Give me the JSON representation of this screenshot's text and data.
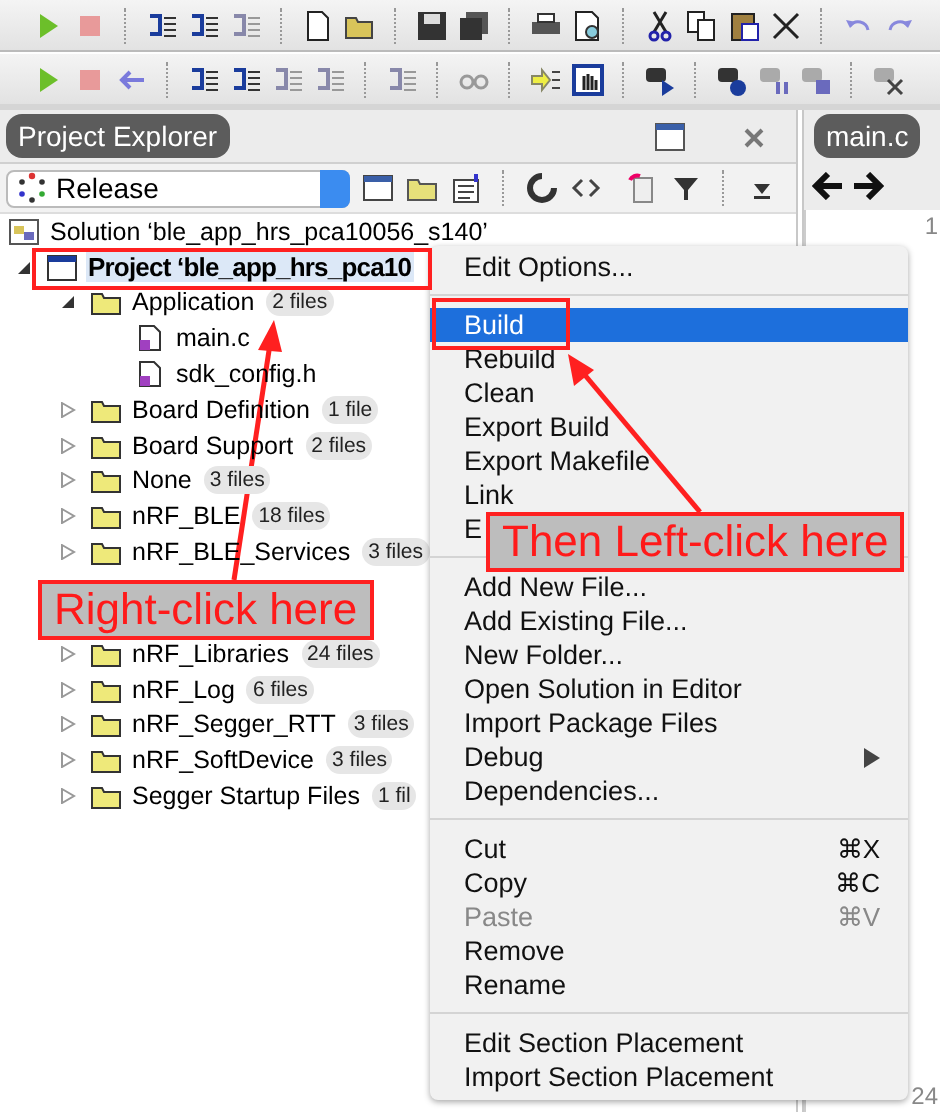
{
  "panel": {
    "title": "Project Explorer",
    "configuration": "Release"
  },
  "editor": {
    "tab": "main.c",
    "line_numbers": [
      "1",
      "24"
    ]
  },
  "tree": [
    {
      "kind": "solution",
      "label": "Solution ‘ble_app_hrs_pca10056_s140’",
      "selected": false,
      "children": [
        {
          "kind": "project",
          "label": "Project ‘ble_app_hrs_pca10",
          "selected": true,
          "expanded": true,
          "children": [
            {
              "kind": "folder",
              "label": "Application",
              "badge": "2 files",
              "selected": false,
              "expanded": true,
              "children": [
                {
                  "kind": "file",
                  "label": "main.c",
                  "selected": false
                },
                {
                  "kind": "file",
                  "label": "sdk_config.h",
                  "selected": false
                }
              ]
            },
            {
              "kind": "folder",
              "label": "Board Definition",
              "badge": "1 file",
              "selected": false,
              "expanded": false
            },
            {
              "kind": "folder",
              "label": "Board Support",
              "badge": "2 files",
              "selected": false,
              "expanded": false
            },
            {
              "kind": "folder",
              "label": "None",
              "badge": "3 files",
              "selected": false,
              "expanded": false
            },
            {
              "kind": "folder",
              "label": "nRF_BLE",
              "badge": "18 files",
              "selected": false,
              "expanded": false
            },
            {
              "kind": "folder",
              "label": "nRF_BLE_Services",
              "badge": "3 files",
              "selected": false,
              "expanded": false
            },
            {
              "kind": "folder",
              "label": "nRF_Libraries",
              "badge": "24 files",
              "selected": false,
              "expanded": false
            },
            {
              "kind": "folder",
              "label": "nRF_Log",
              "badge": "6 files",
              "selected": false,
              "expanded": false
            },
            {
              "kind": "folder",
              "label": "nRF_Segger_RTT",
              "badge": "3 files",
              "selected": false,
              "expanded": false
            },
            {
              "kind": "folder",
              "label": "nRF_SoftDevice",
              "badge": "3 files",
              "selected": false,
              "expanded": false
            },
            {
              "kind": "folder",
              "label": "Segger Startup Files",
              "badge": "1 fil",
              "selected": false,
              "expanded": false
            }
          ]
        }
      ]
    }
  ],
  "context_menu": {
    "sections": [
      [
        {
          "label": "Edit Options...",
          "selected": false,
          "disabled": false,
          "submenu": false
        }
      ],
      [
        {
          "label": "Build",
          "selected": true,
          "disabled": false,
          "submenu": false
        },
        {
          "label": "Rebuild",
          "selected": false,
          "disabled": false,
          "submenu": false
        },
        {
          "label": "Clean",
          "selected": false,
          "disabled": false,
          "submenu": false
        },
        {
          "label": "Export Build",
          "selected": false,
          "disabled": false,
          "submenu": false
        },
        {
          "label": "Export Makefile",
          "selected": false,
          "disabled": false,
          "submenu": false
        },
        {
          "label": "Link",
          "selected": false,
          "disabled": false,
          "submenu": false
        },
        {
          "label": "E",
          "selected": false,
          "disabled": false,
          "submenu": false
        }
      ],
      [
        {
          "label": "Add New File...",
          "selected": false,
          "disabled": false,
          "submenu": false
        },
        {
          "label": "Add Existing File...",
          "selected": false,
          "disabled": false,
          "submenu": false
        },
        {
          "label": "New Folder...",
          "selected": false,
          "disabled": false,
          "submenu": false
        },
        {
          "label": "Open Solution in Editor",
          "selected": false,
          "disabled": false,
          "submenu": false
        },
        {
          "label": "Import Package Files",
          "selected": false,
          "disabled": false,
          "submenu": false
        },
        {
          "label": "Debug",
          "selected": false,
          "disabled": false,
          "submenu": true
        },
        {
          "label": "Dependencies...",
          "selected": false,
          "disabled": false,
          "submenu": false
        }
      ],
      [
        {
          "label": "Cut",
          "shortcut": "⌘X",
          "selected": false,
          "disabled": false,
          "submenu": false
        },
        {
          "label": "Copy",
          "shortcut": "⌘C",
          "selected": false,
          "disabled": false,
          "submenu": false
        },
        {
          "label": "Paste",
          "shortcut": "⌘V",
          "selected": false,
          "disabled": true,
          "submenu": false
        },
        {
          "label": "Remove",
          "selected": false,
          "disabled": false,
          "submenu": false
        },
        {
          "label": "Rename",
          "selected": false,
          "disabled": false,
          "submenu": false
        }
      ],
      [
        {
          "label": "Edit Section Placement",
          "selected": false,
          "disabled": false,
          "submenu": false
        },
        {
          "label": "Import Section Placement",
          "selected": false,
          "disabled": false,
          "submenu": false
        }
      ]
    ]
  },
  "annotations": [
    {
      "text": "Right-click here"
    },
    {
      "text": "Then Left-click here"
    }
  ]
}
